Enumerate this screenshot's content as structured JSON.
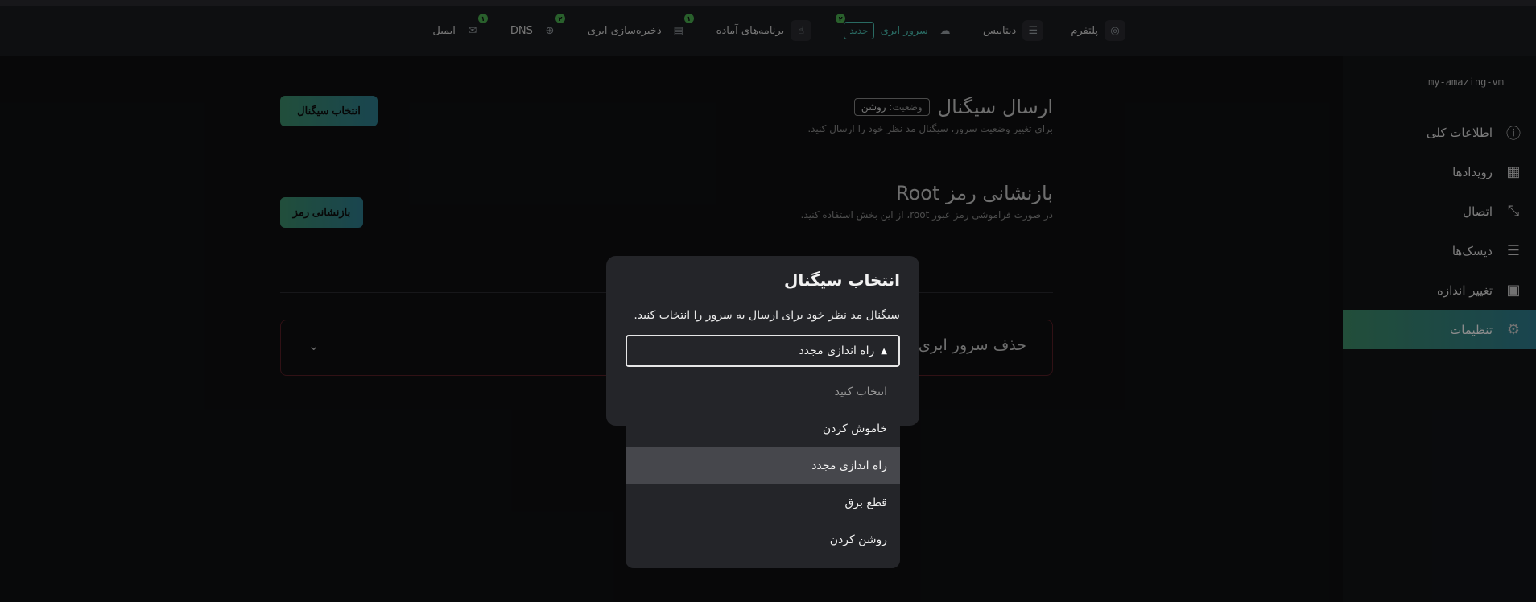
{
  "topnav": {
    "items": [
      {
        "label": "پلتفرم",
        "icon": "platform-icon"
      },
      {
        "label": "دیتابیس",
        "icon": "database-icon"
      },
      {
        "label": "سرور ابری",
        "icon": "cloud-icon",
        "badge": "۲",
        "new_label": "جدید"
      },
      {
        "label": "برنامه‌های آماده",
        "icon": "apps-icon"
      },
      {
        "label": "ذخیره‌سازی ابری",
        "icon": "archive-icon",
        "badge": "۱"
      },
      {
        "label": "DNS",
        "icon": "globe-icon",
        "badge": "۲"
      },
      {
        "label": "ایمیل",
        "icon": "mail-icon",
        "badge": "۱"
      }
    ]
  },
  "sidebar": {
    "vm_name": "my-amazing-vm",
    "items": [
      {
        "label": "اطلاعات کلی",
        "icon": "info-icon"
      },
      {
        "label": "رویدادها",
        "icon": "grid-icon"
      },
      {
        "label": "اتصال",
        "icon": "connect-icon"
      },
      {
        "label": "دیسک‌ها",
        "icon": "disks-icon"
      },
      {
        "label": "تغییر اندازه",
        "icon": "cpu-icon"
      },
      {
        "label": "تنظیمات",
        "icon": "gear-icon",
        "active": true
      }
    ]
  },
  "send_signal": {
    "title": "ارسال سیگنال",
    "status_prefix": "وضعیت:",
    "status_value": "روشن",
    "description": "برای تغییر وضعیت سرور، سیگنال مد نظر خود را ارسال کنید.",
    "button": "انتخاب سیگنال"
  },
  "reset_root": {
    "title": "بازنشانی رمز Root",
    "description": "در صورت فراموشی رمز عبور root، از این بخش استفاده کنید.",
    "button": "بازنشانی رمز"
  },
  "delete_server": {
    "title": "حذف سرور ابری"
  },
  "modal": {
    "title": "انتخاب سیگنال",
    "description": "سیگنال مد نظر خود برای ارسال به سرور را انتخاب کنید.",
    "selected": "راه اندازی مجدد",
    "placeholder": "انتخاب کنید",
    "options": [
      "خاموش کردن",
      "راه اندازی مجدد",
      "قطع برق",
      "روشن کردن"
    ],
    "highlighted_index": 1
  },
  "colors": {
    "accent_start": "#3e8e6a",
    "accent_end": "#2f7d8f",
    "badge": "#4caf50",
    "danger_border": "#5a1f27"
  }
}
